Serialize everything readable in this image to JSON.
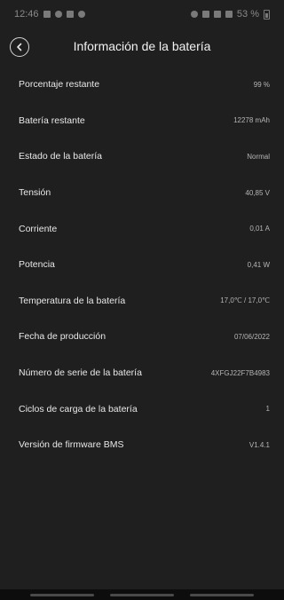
{
  "status_bar": {
    "time": "12:46",
    "battery": "53 %"
  },
  "header": {
    "title": "Información de la batería"
  },
  "rows": [
    {
      "label": "Porcentaje restante",
      "value": "99 %"
    },
    {
      "label": "Batería restante",
      "value": "12278 mAh"
    },
    {
      "label": "Estado de la batería",
      "value": "Normal"
    },
    {
      "label": "Tensión",
      "value": "40,85 V"
    },
    {
      "label": "Corriente",
      "value": "0,01 A"
    },
    {
      "label": "Potencia",
      "value": "0,41 W"
    },
    {
      "label": "Temperatura de la batería",
      "value": "17,0℃ / 17,0℃"
    },
    {
      "label": "Fecha de producción",
      "value": "07/06/2022"
    },
    {
      "label": "Número de serie de la batería",
      "value": "4XFGJ22F7B4983"
    },
    {
      "label": "Ciclos de carga de la batería",
      "value": "1"
    },
    {
      "label": "Versión de firmware BMS",
      "value": "V1.4.1"
    }
  ]
}
